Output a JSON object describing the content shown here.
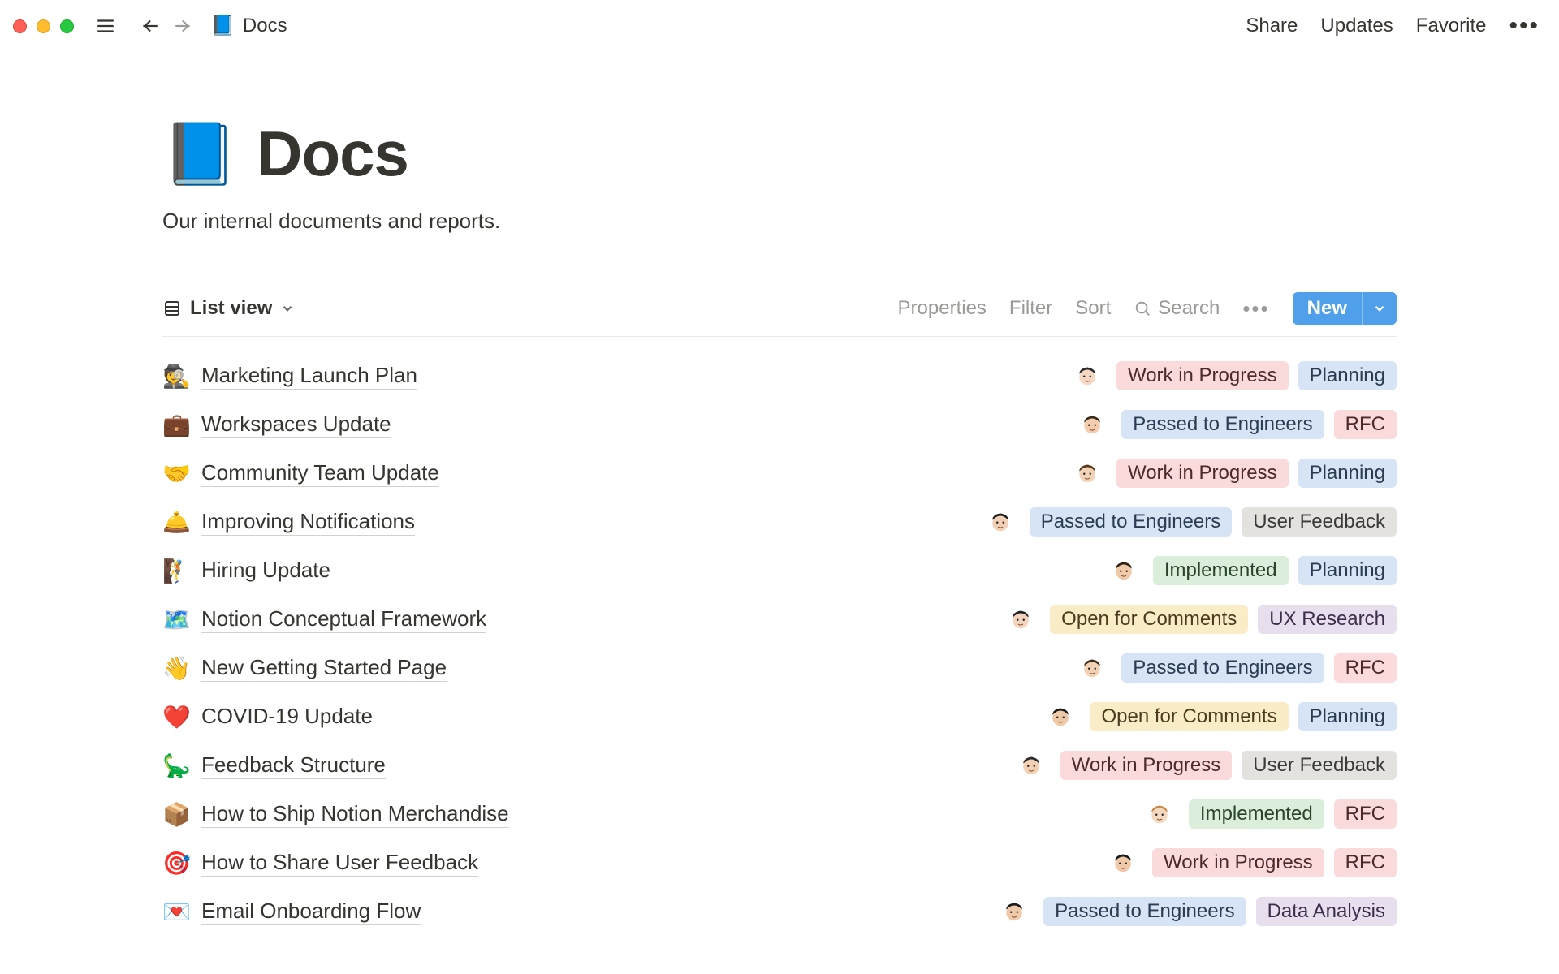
{
  "header": {
    "breadcrumb_icon": "📘",
    "breadcrumb_label": "Docs",
    "share": "Share",
    "updates": "Updates",
    "favorite": "Favorite"
  },
  "page": {
    "icon": "📘",
    "title": "Docs",
    "subtitle": "Our internal documents and reports."
  },
  "toolbar": {
    "view_label": "List view",
    "properties": "Properties",
    "filter": "Filter",
    "sort": "Sort",
    "search": "Search",
    "new_label": "New"
  },
  "tag_palette": {
    "Work in Progress": "pink",
    "Planning": "blue",
    "Passed to Engineers": "blue",
    "RFC": "pink",
    "User Feedback": "gray",
    "Implemented": "green",
    "Open for Comments": "yellow",
    "UX Research": "purple",
    "Data Analysis": "purple"
  },
  "avatars": [
    {
      "id": 0,
      "hair": "#2b2b2b",
      "skin": "#f6d7c4"
    },
    {
      "id": 1,
      "hair": "#3a2a1a",
      "skin": "#f3cdae"
    },
    {
      "id": 2,
      "hair": "#5b3a1a",
      "skin": "#f2d3b8"
    },
    {
      "id": 3,
      "hair": "#1a1a1a",
      "skin": "#f1cfb5"
    },
    {
      "id": 4,
      "hair": "#2e2115",
      "skin": "#f0caa8"
    },
    {
      "id": 5,
      "hair": "#222",
      "skin": "#f4d4bc"
    },
    {
      "id": 6,
      "hair": "#3a2a1a",
      "skin": "#f3d1b4"
    },
    {
      "id": 7,
      "hair": "#1a1a1a",
      "skin": "#eec9a8"
    },
    {
      "id": 8,
      "hair": "#2b2b2b",
      "skin": "#f3d0b4"
    },
    {
      "id": 9,
      "hair": "#c98b4a",
      "skin": "#f5d8c0"
    },
    {
      "id": 10,
      "hair": "#1a1a1a",
      "skin": "#efc9a9"
    },
    {
      "id": 11,
      "hair": "#1a1a1a",
      "skin": "#f0caa8"
    }
  ],
  "rows": [
    {
      "icon": "🕵️",
      "title": "Marketing Launch Plan",
      "avatar": 0,
      "tags": [
        "Work in Progress",
        "Planning"
      ]
    },
    {
      "icon": "💼",
      "title": "Workspaces Update",
      "avatar": 1,
      "tags": [
        "Passed to Engineers",
        "RFC"
      ]
    },
    {
      "icon": "🤝",
      "title": "Community Team Update",
      "avatar": 2,
      "tags": [
        "Work in Progress",
        "Planning"
      ]
    },
    {
      "icon": "🛎️",
      "title": "Improving Notifications",
      "avatar": 3,
      "tags": [
        "Passed to Engineers",
        "User Feedback"
      ]
    },
    {
      "icon": "🧗",
      "title": "Hiring Update",
      "avatar": 4,
      "tags": [
        "Implemented",
        "Planning"
      ]
    },
    {
      "icon": "🗺️",
      "title": "Notion Conceptual Framework",
      "avatar": 5,
      "tags": [
        "Open for Comments",
        "UX Research"
      ]
    },
    {
      "icon": "👋",
      "title": "New Getting Started Page",
      "avatar": 6,
      "tags": [
        "Passed to Engineers",
        "RFC"
      ]
    },
    {
      "icon": "❤️",
      "title": "COVID-19 Update",
      "avatar": 7,
      "tags": [
        "Open for Comments",
        "Planning"
      ]
    },
    {
      "icon": "🦕",
      "title": "Feedback Structure",
      "avatar": 8,
      "tags": [
        "Work in Progress",
        "User Feedback"
      ]
    },
    {
      "icon": "📦",
      "title": "How to Ship Notion Merchandise",
      "avatar": 9,
      "tags": [
        "Implemented",
        "RFC"
      ]
    },
    {
      "icon": "🎯",
      "title": "How to Share User Feedback",
      "avatar": 10,
      "tags": [
        "Work in Progress",
        "RFC"
      ]
    },
    {
      "icon": "💌",
      "title": "Email Onboarding Flow",
      "avatar": 11,
      "tags": [
        "Passed to Engineers",
        "Data Analysis"
      ]
    }
  ]
}
